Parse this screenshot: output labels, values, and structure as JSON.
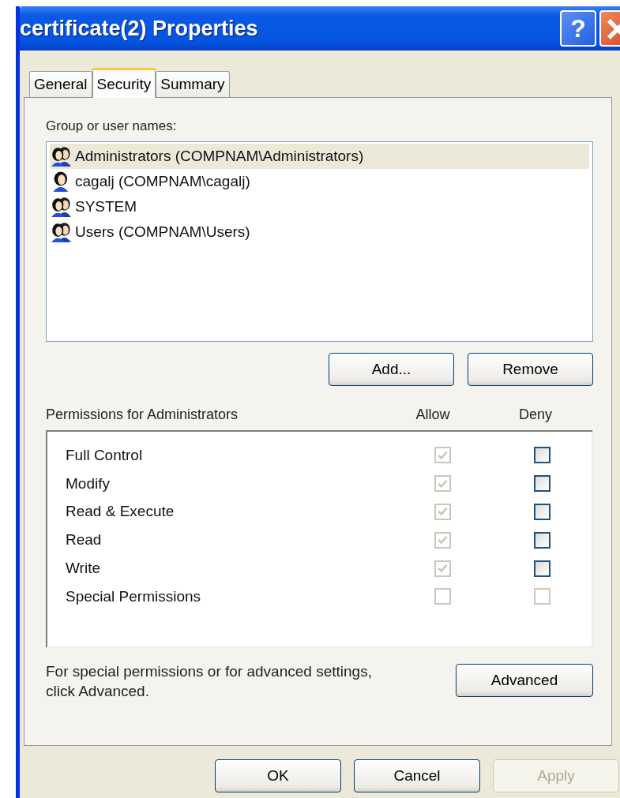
{
  "window": {
    "title": "certificate(2) Properties",
    "help_button": "?"
  },
  "tabs": [
    {
      "label": "General",
      "selected": false
    },
    {
      "label": "Security",
      "selected": true
    },
    {
      "label": "Summary",
      "selected": false
    }
  ],
  "group_label": "Group or user names:",
  "users": [
    {
      "name": "Administrators (COMPNAM\\Administrators)",
      "kind": "group",
      "selected": true
    },
    {
      "name": "cagalj (COMPNAM\\cagalj)",
      "kind": "user",
      "selected": false
    },
    {
      "name": "SYSTEM",
      "kind": "group",
      "selected": false
    },
    {
      "name": "Users (COMPNAM\\Users)",
      "kind": "group",
      "selected": false
    }
  ],
  "user_buttons": [
    {
      "label": "Add..."
    },
    {
      "label": "Remove"
    }
  ],
  "permissions_label": "Permissions for Administrators",
  "columns": [
    "Allow",
    "Deny"
  ],
  "permissions": [
    {
      "name": "Full Control",
      "allow": {
        "checked": true,
        "disabled": true
      },
      "deny": {
        "checked": false,
        "disabled": false
      }
    },
    {
      "name": "Modify",
      "allow": {
        "checked": true,
        "disabled": true
      },
      "deny": {
        "checked": false,
        "disabled": false
      }
    },
    {
      "name": "Read & Execute",
      "allow": {
        "checked": true,
        "disabled": true
      },
      "deny": {
        "checked": false,
        "disabled": false
      }
    },
    {
      "name": "Read",
      "allow": {
        "checked": true,
        "disabled": true
      },
      "deny": {
        "checked": false,
        "disabled": false
      }
    },
    {
      "name": "Write",
      "allow": {
        "checked": true,
        "disabled": true
      },
      "deny": {
        "checked": false,
        "disabled": false
      }
    },
    {
      "name": "Special Permissions",
      "allow": {
        "checked": false,
        "disabled": true
      },
      "deny": {
        "checked": false,
        "disabled": true
      }
    }
  ],
  "advanced_note": "For special permissions or for advanced settings, click Advanced.",
  "advanced_button": "Advanced",
  "buttons": [
    {
      "label": "OK",
      "disabled": false
    },
    {
      "label": "Cancel",
      "disabled": false
    },
    {
      "label": "Apply",
      "disabled": true
    }
  ]
}
